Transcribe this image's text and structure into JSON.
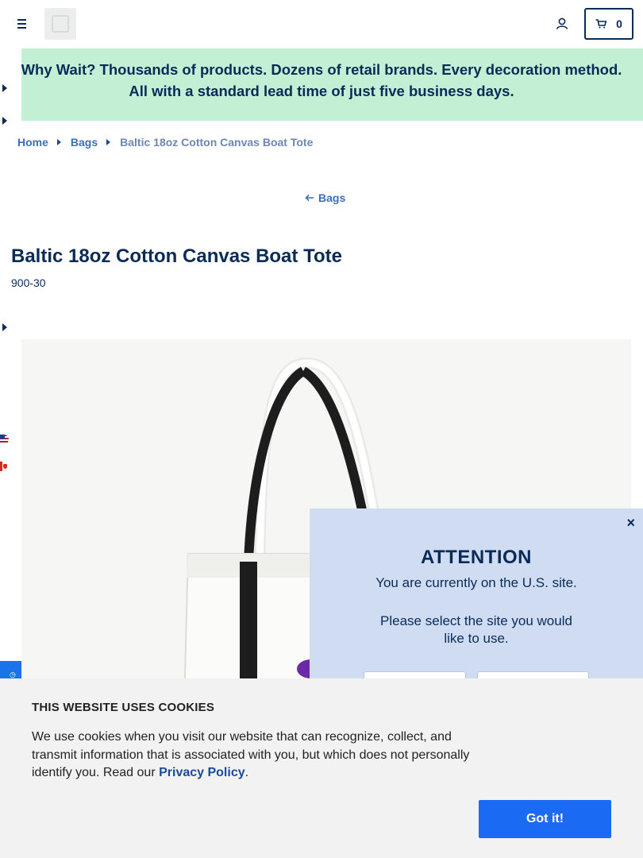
{
  "header": {
    "menu_icon": "hamburger-icon",
    "logo_icon": "brand-logo",
    "account_icon": "user-icon",
    "cart": {
      "icon": "cart-icon",
      "count": "0"
    }
  },
  "promo": {
    "text": "Why Wait? Thousands of products. Dozens of retail brands. Every decoration method. All with a standard lead time of just five business days."
  },
  "breadcrumb": {
    "items": [
      "Home",
      "Bags"
    ],
    "current": "Baltic 18oz Cotton Canvas Boat Tote"
  },
  "back_link": {
    "icon": "arrow-left-icon",
    "label": "Bags"
  },
  "product": {
    "title": "Baltic 18oz Cotton Canvas Boat Tote",
    "sku": "900-30"
  },
  "attention_modal": {
    "close": "×",
    "heading": "ATTENTION",
    "line1": "You are currently on the U.S. site.",
    "line2": "Please select the site you would like to use."
  },
  "cookie_banner": {
    "heading": "THIS WEBSITE USES COOKIES",
    "body": "We use cookies when you visit our website that can recognize, collect, and transmit information that is associated with you, but which does not personally identify you. Read our ",
    "link": "Privacy Policy",
    "end": ".",
    "button": "Got it!"
  },
  "colors": {
    "navy": "#0b2b57",
    "promo_bg": "#c3efd5",
    "link_blue": "#3d6fb8",
    "accept_blue": "#1a6af4",
    "modal_bg": "#cfdcf2"
  }
}
